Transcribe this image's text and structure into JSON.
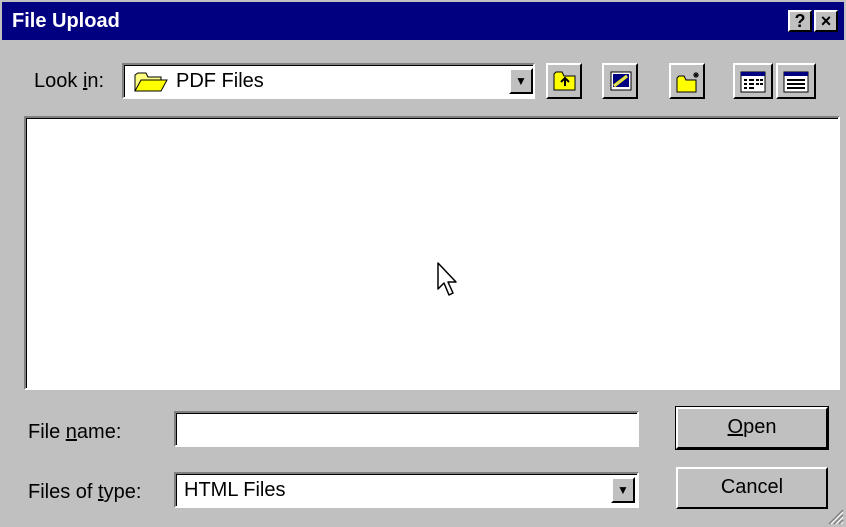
{
  "window": {
    "title": "File Upload",
    "help_label": "?",
    "close_label": "×"
  },
  "lookin": {
    "label_pre": "Look ",
    "label_accel": "i",
    "label_post": "n:",
    "value": "PDF Files"
  },
  "toolbar": {
    "icons": [
      "up-one-level-icon",
      "desktop-icon",
      "new-folder-icon",
      "list-view-icon",
      "details-view-icon"
    ]
  },
  "filename": {
    "label_pre": "File ",
    "label_accel": "n",
    "label_post": "ame:",
    "value": ""
  },
  "filetype": {
    "label_pre": "Files of ",
    "label_accel": "t",
    "label_post": "ype:",
    "value": "HTML Files"
  },
  "buttons": {
    "open_accel": "O",
    "open_rest": "pen",
    "cancel": "Cancel"
  },
  "colors": {
    "titlebar": "#000080",
    "face": "#c0c0c0",
    "window": "#ffffff"
  }
}
